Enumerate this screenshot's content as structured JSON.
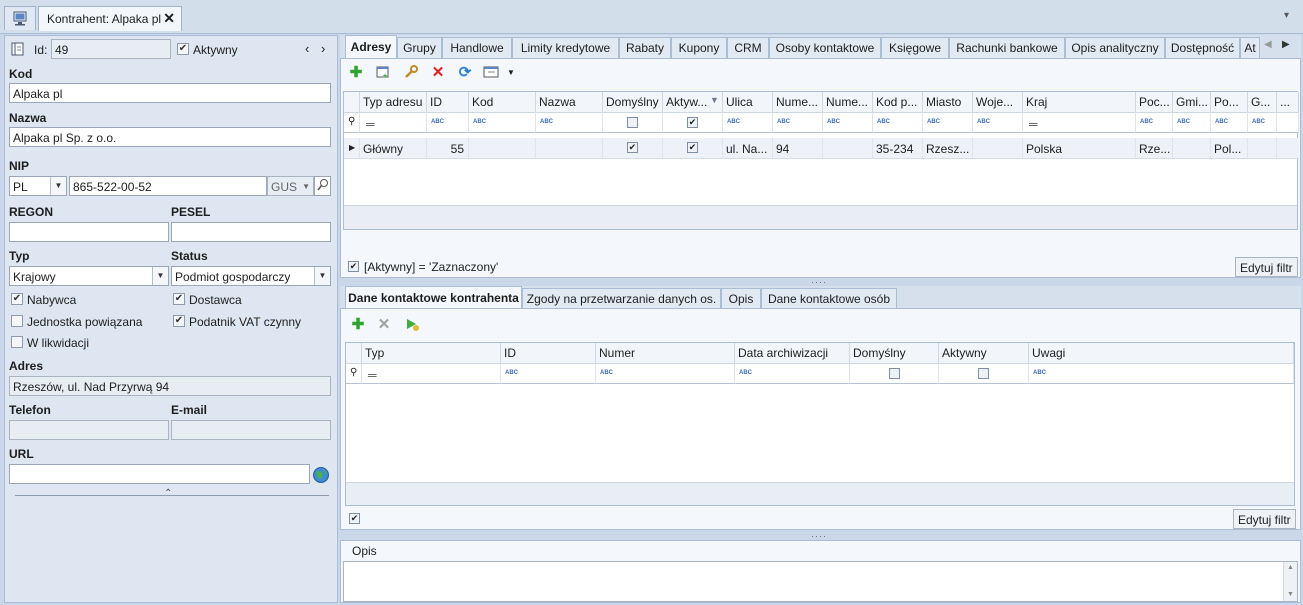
{
  "window": {
    "doc_tab_title": "Kontrahent: Alpaka pl",
    "close_glyph": "✕",
    "overflow_glyph": "▾"
  },
  "left": {
    "id_label": "Id:",
    "id_value": "49",
    "aktywny_label": "Aktywny",
    "aktywny_checked": true,
    "kod_label": "Kod",
    "kod_value": "Alpaka pl",
    "nazwa_label": "Nazwa",
    "nazwa_value": "Alpaka pl Sp. z o.o.",
    "nip_label": "NIP",
    "nip_country": "PL",
    "nip_value": "865-522-00-52",
    "gus_label": "GUS",
    "regon_label": "REGON",
    "regon_value": "",
    "pesel_label": "PESEL",
    "pesel_value": "",
    "typ_label": "Typ",
    "typ_value": "Krajowy",
    "status_label": "Status",
    "status_value": "Podmiot gospodarczy",
    "checkboxes": [
      {
        "label": "Nabywca",
        "checked": true
      },
      {
        "label": "Dostawca",
        "checked": true
      },
      {
        "label": "Jednostka powiązana",
        "checked": false
      },
      {
        "label": "Podatnik VAT czynny",
        "checked": true
      },
      {
        "label": "W likwidacji",
        "checked": false
      }
    ],
    "adres_label": "Adres",
    "adres_value": "Rzeszów, ul. Nad Przyrwą  94",
    "telefon_label": "Telefon",
    "telefon_value": "",
    "email_label": "E-mail",
    "email_value": "",
    "url_label": "URL",
    "url_value": ""
  },
  "tabs": [
    {
      "label": "Adresy",
      "active": true
    },
    {
      "label": "Grupy"
    },
    {
      "label": "Handlowe"
    },
    {
      "label": "Limity kredytowe"
    },
    {
      "label": "Rabaty"
    },
    {
      "label": "Kupony"
    },
    {
      "label": "CRM"
    },
    {
      "label": "Osoby kontaktowe"
    },
    {
      "label": "Księgowe"
    },
    {
      "label": "Rachunki bankowe"
    },
    {
      "label": "Opis analityczny"
    },
    {
      "label": "Dostępność"
    },
    {
      "label": "At"
    }
  ],
  "addresses": {
    "columns": [
      "Typ adresu",
      "ID",
      "Kod",
      "Nazwa",
      "Domyślny",
      "Aktyw...",
      "Ulica",
      "Nume...",
      "Nume...",
      "Kod p...",
      "Miasto",
      "Woje...",
      "Kraj",
      "Poc...",
      "Gmi...",
      "Po...",
      "G...",
      "..."
    ],
    "row": {
      "typ": "Główny",
      "id": "55",
      "kod": "",
      "nazwa": "",
      "domyslny": true,
      "aktywny": true,
      "ulica": "ul. Na...",
      "numer1": "94",
      "numer2": "",
      "kod_pocztowy": "35-234",
      "miasto": "Rzesz...",
      "wojewodztwo": "",
      "kraj": "Polska",
      "poczta": "Rze...",
      "gmina": "",
      "powiat": "Pol...",
      "g": ""
    },
    "filter_text": "[Aktywny] = 'Zaznaczony'",
    "edit_filter_label": "Edytuj filtr"
  },
  "contact_tabs": [
    {
      "label": "Dane kontaktowe kontrahenta",
      "active": true
    },
    {
      "label": "Zgody na przetwarzanie danych os."
    },
    {
      "label": "Opis"
    },
    {
      "label": "Dane kontaktowe osób"
    }
  ],
  "contacts": {
    "columns": [
      "Typ",
      "ID",
      "Numer",
      "Data archiwizacji",
      "Domyślny",
      "Aktywny",
      "Uwagi"
    ],
    "edit_filter_label": "Edytuj filtr"
  },
  "opis": {
    "label": "Opis",
    "value": ""
  }
}
